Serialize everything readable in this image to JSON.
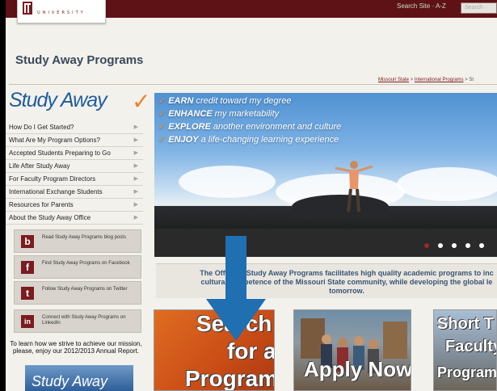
{
  "header": {
    "logo_university": "UNIVERSITY",
    "top_links": "Search Site · A-Z",
    "search_placeholder": "Search"
  },
  "page_title": "Study Away Programs",
  "breadcrumb": {
    "items": [
      "Missouri State",
      "International Programs"
    ],
    "separator": " > ",
    "current": "St"
  },
  "sidebar": {
    "brand": "Study Away",
    "brand_check": "✓",
    "menu_items": [
      "How Do I Get Started?",
      "What Are My Program Options?",
      "Accepted Students Preparing to Go",
      "Life After Study Away",
      "For Faculty Program Directors",
      "International Exchange Students",
      "Resources for Parents",
      "About the Study Away Office"
    ],
    "arrow": "▶",
    "social": [
      {
        "icon": "b",
        "icon_name": "blog-icon",
        "text": "Read Study Away Programs blog posts"
      },
      {
        "icon": "f",
        "icon_name": "facebook-icon",
        "text": "Find Study Away Programs on Facebook"
      },
      {
        "icon": "t",
        "icon_name": "twitter-icon",
        "text": "Follow Study Away Programs on Twitter"
      },
      {
        "icon": "in",
        "icon_name": "linkedin-icon",
        "text": "Connect with Study Away Programs on LinkedIn"
      }
    ],
    "mission_text": "To learn how we strive to achieve our mission, please, enjoy our 2012/2013 Annual Report.",
    "annual_report_image_text": "Study Away"
  },
  "hero": {
    "check": "✓",
    "lines": [
      {
        "bold": "EARN",
        "rest": " credit toward my degree"
      },
      {
        "bold": "ENHANCE",
        "rest": " my marketability"
      },
      {
        "bold": "EXPLORE",
        "rest": " another environment and culture"
      },
      {
        "bold": "ENJOY",
        "rest": " a life-changing learning experience"
      }
    ],
    "slide_count": 6,
    "active_slide": 1
  },
  "intro_text": {
    "line1": "The Office of Study Away Programs facilitates high quality academic programs to inc",
    "line2": "cultural competence of the Missouri State community, while developing the global le",
    "line3": "tomorrow."
  },
  "tiles": {
    "search": {
      "line1": "Search",
      "line2": "for a",
      "line3": "Program"
    },
    "apply": {
      "label": "Apply Now"
    },
    "short_term": {
      "line1": "Short T",
      "line2": "Faculty",
      "line3": "Program"
    }
  },
  "colors": {
    "maroon": "#5e1216",
    "brand_blue": "#1f5c9e",
    "accent_orange": "#e8862a",
    "arrow_blue": "#1f6fb1",
    "title_slate": "#3a4a5b"
  }
}
